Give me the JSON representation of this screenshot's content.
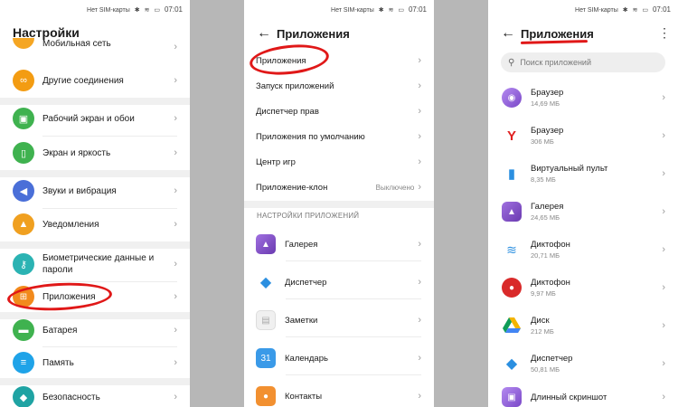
{
  "status": {
    "carrier": "Нет SIM-карты",
    "time": "07:01"
  },
  "settings": {
    "title": "Настройки",
    "items": [
      {
        "label": "Мобильная сеть",
        "icon": "signal-icon",
        "color": "#f5a623"
      },
      {
        "label": "Другие соединения",
        "icon": "link-icon",
        "color": "#f39c12"
      },
      {
        "label": "Рабочий экран и обои",
        "icon": "image-icon",
        "color": "#3fb24f"
      },
      {
        "label": "Экран и яркость",
        "icon": "phone-icon",
        "color": "#3fb24f"
      },
      {
        "label": "Звуки и вибрация",
        "icon": "volume-icon",
        "color": "#4a6fd8"
      },
      {
        "label": "Уведомления",
        "icon": "bell-icon",
        "color": "#f0a020"
      },
      {
        "label": "Биометрические данные и пароли",
        "icon": "key-icon",
        "color": "#2bb3b3"
      },
      {
        "label": "Приложения",
        "icon": "apps-grid-icon",
        "color": "#f28a1c"
      },
      {
        "label": "Батарея",
        "icon": "battery-icon",
        "color": "#3fb24f"
      },
      {
        "label": "Память",
        "icon": "storage-icon",
        "color": "#1fa3e8"
      },
      {
        "label": "Безопасность",
        "icon": "shield-icon",
        "color": "#1fa3a3"
      }
    ]
  },
  "apps_menu": {
    "title": "Приложения",
    "items": [
      {
        "label": "Приложения",
        "value": ""
      },
      {
        "label": "Запуск приложений",
        "value": ""
      },
      {
        "label": "Диспетчер прав",
        "value": ""
      },
      {
        "label": "Приложения по умолчанию",
        "value": ""
      },
      {
        "label": "Центр игр",
        "value": ""
      },
      {
        "label": "Приложение-клон",
        "value": "Выключено"
      }
    ],
    "section_title": "НАСТРОЙКИ ПРИЛОЖЕНИЙ",
    "app_settings": [
      {
        "label": "Галерея",
        "icon": "gallery-icon",
        "color": "#8a56c8"
      },
      {
        "label": "Диспетчер",
        "icon": "shield-icon",
        "color": "#2b8fe0"
      },
      {
        "label": "Заметки",
        "icon": "notes-icon",
        "color": "#e8e8e8"
      },
      {
        "label": "Календарь",
        "icon": "calendar-icon",
        "color": "#3a9ae8",
        "text": "31"
      },
      {
        "label": "Контакты",
        "icon": "contacts-icon",
        "color": "#f29030"
      }
    ]
  },
  "apps_list": {
    "title": "Приложения",
    "search_placeholder": "Поиск приложений",
    "apps": [
      {
        "name": "Браузер",
        "size": "14,69 МБ",
        "icon": "browser-icon",
        "color": "#9a66d8"
      },
      {
        "name": "Браузер",
        "size": "306 МБ",
        "icon": "yandex-icon",
        "color": "#ffffff",
        "text": "Y"
      },
      {
        "name": "Виртуальный пульт",
        "size": "8,35 МБ",
        "icon": "remote-icon",
        "color": "#2b8fe0"
      },
      {
        "name": "Галерея",
        "size": "24,65 МБ",
        "icon": "gallery-icon",
        "color": "#8a56c8"
      },
      {
        "name": "Диктофон",
        "size": "20,71 МБ",
        "icon": "waveform-icon",
        "color": "#ffffff"
      },
      {
        "name": "Диктофон",
        "size": "9,97 МБ",
        "icon": "microphone-icon",
        "color": "#d92a2a"
      },
      {
        "name": "Диск",
        "size": "212 МБ",
        "icon": "drive-icon",
        "color": "#ffffff"
      },
      {
        "name": "Диспетчер",
        "size": "50,81 МБ",
        "icon": "shield-icon",
        "color": "#2b8fe0"
      },
      {
        "name": "Длинный скриншот",
        "size": "",
        "icon": "screenshot-icon",
        "color": "#9a66d8"
      }
    ]
  }
}
